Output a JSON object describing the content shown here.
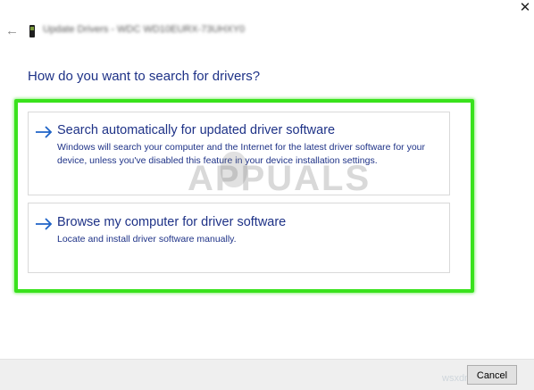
{
  "window": {
    "title": "Update Drivers - WDC WD10EURX-73UHXY0",
    "back_icon": "back-arrow-icon",
    "close_icon": "close-x-icon"
  },
  "heading": "How do you want to search for drivers?",
  "options": [
    {
      "title": "Search automatically for updated driver software",
      "description": "Windows will search your computer and the Internet for the latest driver software for your device, unless you've disabled this feature in your device installation settings.",
      "icon": "right-arrow-icon"
    },
    {
      "title": "Browse my computer for driver software",
      "description": "Locate and install driver software manually.",
      "icon": "right-arrow-icon"
    }
  ],
  "footer": {
    "cancel_label": "Cancel"
  },
  "watermarks": {
    "brand": "APPUALS",
    "site": "wsxdn.com"
  },
  "colors": {
    "link_blue": "#1e3287",
    "highlight_green": "#39e21c",
    "footer_bg": "#efefef"
  }
}
